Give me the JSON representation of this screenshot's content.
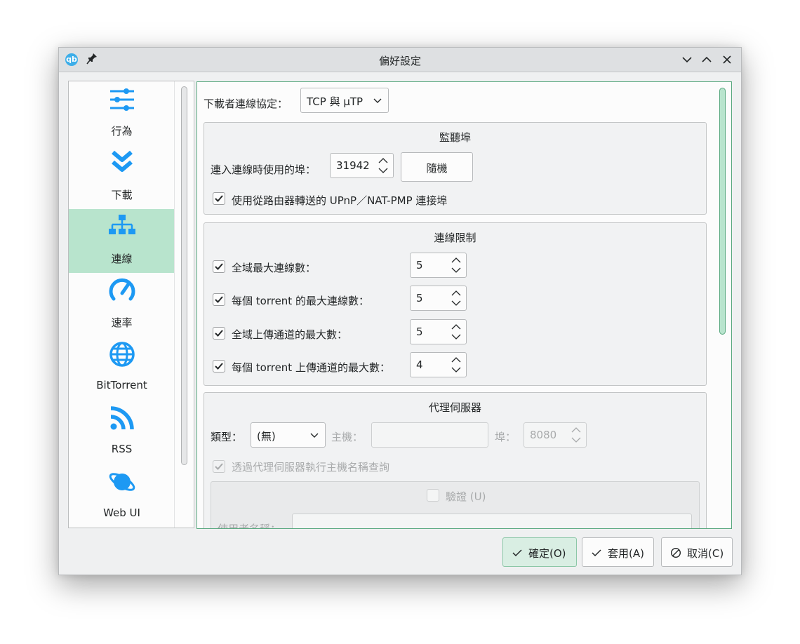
{
  "window": {
    "title": "偏好設定"
  },
  "sidebar": {
    "items": [
      {
        "label": "行為",
        "icon": "sliders-icon"
      },
      {
        "label": "下載",
        "icon": "double-chevron-down-icon"
      },
      {
        "label": "連線",
        "icon": "network-icon",
        "active": true
      },
      {
        "label": "速率",
        "icon": "speedometer-icon"
      },
      {
        "label": "BitTorrent",
        "icon": "globe-icon"
      },
      {
        "label": "RSS",
        "icon": "rss-icon"
      },
      {
        "label": "Web UI",
        "icon": "planet-icon"
      }
    ]
  },
  "connection": {
    "protocol_label": "下載者連線協定：",
    "protocol_value": "TCP 與 μTP",
    "listening_port": {
      "title": "監聽埠",
      "port_label": "連入連線時使用的埠：",
      "port_value": "31942",
      "random_button": "隨機",
      "upnp_label": "使用從路由器轉送的 UPnP／NAT-PMP 連接埠",
      "upnp_checked": true
    },
    "limits": {
      "title": "連線限制",
      "rows": [
        {
          "label": "全域最大連線數：",
          "value": "5",
          "checked": true
        },
        {
          "label": "每個 torrent 的最大連線數：",
          "value": "5",
          "checked": true
        },
        {
          "label": "全域上傳通道的最大數：",
          "value": "5",
          "checked": true
        },
        {
          "label": "每個 torrent 上傳通道的最大數：",
          "value": "4",
          "checked": true
        }
      ]
    },
    "proxy": {
      "title": "代理伺服器",
      "type_label": "類型：",
      "type_value": "(無)",
      "host_label": "主機：",
      "host_value": "",
      "port_label": "埠：",
      "port_value": "8080",
      "hostname_lookup_label": "透過代理伺服器執行主機名稱查詢",
      "hostname_lookup_checked": true,
      "auth": {
        "label": "驗證 (U)",
        "checked": false,
        "username_label": "使用者名稱："
      }
    }
  },
  "footer": {
    "ok": "確定(O)",
    "apply": "套用(A)",
    "cancel": "取消(C)"
  },
  "colors": {
    "accent": "#3daee9",
    "selection": "#b8e4cd",
    "focus": "#5aa980"
  }
}
